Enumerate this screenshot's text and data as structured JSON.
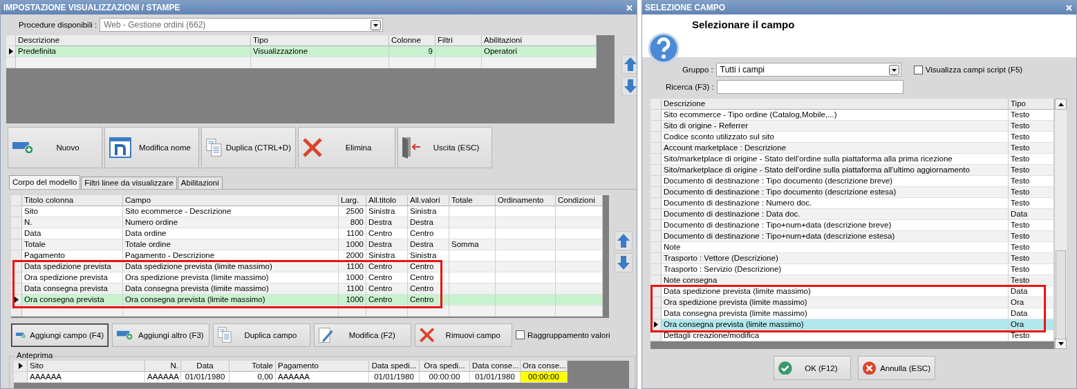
{
  "main_window": {
    "title": "IMPOSTAZIONE VISUALIZZAZIONI / STAMPE",
    "procedure": {
      "label": "Procedure disponibili :",
      "value": "Web - Gestione ordini (662)"
    },
    "models_table": {
      "columns": [
        "Descrizione",
        "Tipo",
        "Colonne",
        "Filtri",
        "Abilitazioni"
      ],
      "rows": [
        {
          "cells": [
            "Predefinita",
            "Visualizzazione",
            "9",
            "",
            "Operatori"
          ],
          "selected": true
        }
      ]
    },
    "toolbar": [
      {
        "label": "Nuovo",
        "kind": "new"
      },
      {
        "label": "Modifica nome",
        "kind": "rename"
      },
      {
        "label": "Duplica (CTRL+D)",
        "kind": "duplicate"
      },
      {
        "label": "Elimina",
        "kind": "delete"
      },
      {
        "label": "Uscita (ESC)",
        "kind": "exit"
      }
    ],
    "tabs": [
      {
        "label": "Corpo del modello",
        "selected": true
      },
      {
        "label": "Filtri linee da visualizzare",
        "selected": false
      },
      {
        "label": "Abilitazioni",
        "selected": false
      }
    ],
    "columns_table": {
      "columns": [
        "Titolo colonna",
        "Campo",
        "Larg.",
        "All.titolo",
        "All.valori",
        "Totale",
        "Ordinamento",
        "Condizioni"
      ],
      "rows": [
        {
          "cells": [
            "Sito",
            "Sito ecommerce - Descrizione",
            "2500",
            "Sinistra",
            "Sinistra",
            "",
            "",
            ""
          ],
          "selected": false,
          "marked": false
        },
        {
          "cells": [
            "N.",
            "Numero ordine",
            "800",
            "Destra",
            "Destra",
            "",
            "",
            ""
          ],
          "selected": false,
          "marked": false
        },
        {
          "cells": [
            "Data",
            "Data ordine",
            "1100",
            "Centro",
            "Centro",
            "",
            "",
            ""
          ],
          "selected": false,
          "marked": false
        },
        {
          "cells": [
            "Totale",
            "Totale ordine",
            "1000",
            "Destra",
            "Destra",
            "Somma",
            "",
            ""
          ],
          "selected": false,
          "marked": false
        },
        {
          "cells": [
            "Pagamento",
            "Pagamento - Descrizione",
            "2000",
            "Sinistra",
            "Sinistra",
            "",
            "",
            ""
          ],
          "selected": false,
          "marked": false
        },
        {
          "cells": [
            "Data spedizione prevista",
            "Data spedizione prevista (limite massimo)",
            "1100",
            "Centro",
            "Centro",
            "",
            "",
            ""
          ],
          "selected": false,
          "marked": true
        },
        {
          "cells": [
            "Ora spedizione prevista",
            "Ora spedizione prevista (limite massimo)",
            "1000",
            "Centro",
            "Centro",
            "",
            "",
            ""
          ],
          "selected": false,
          "marked": true
        },
        {
          "cells": [
            "Data consegna prevista",
            "Data consegna prevista (limite massimo)",
            "1100",
            "Centro",
            "Centro",
            "",
            "",
            ""
          ],
          "selected": false,
          "marked": true
        },
        {
          "cells": [
            "Ora consegna prevista",
            "Ora consegna prevista (limite massimo)",
            "1000",
            "Centro",
            "Centro",
            "",
            "",
            ""
          ],
          "selected": true,
          "marked": true
        }
      ]
    },
    "field_buttons": [
      {
        "label": "Aggiungi campo (F4)",
        "kind": "new",
        "focused": true
      },
      {
        "label": "Aggiungi altro (F3)",
        "kind": "new",
        "focused": false
      },
      {
        "label": "Duplica campo",
        "kind": "duplicate",
        "focused": false
      },
      {
        "label": "Modifica (F2)",
        "kind": "edit",
        "focused": false
      },
      {
        "label": "Rimuovi campo",
        "kind": "delete",
        "focused": false
      }
    ],
    "grouping_checkbox": {
      "label": "Raggruppamento valori",
      "checked": false
    },
    "preview": {
      "title": "Anteprima",
      "columns": [
        {
          "label": "Sito",
          "kind": "text",
          "highlighted": false
        },
        {
          "label": "N.",
          "kind": "number",
          "highlighted": false
        },
        {
          "label": "Data",
          "kind": "date",
          "highlighted": false
        },
        {
          "label": "Totale",
          "kind": "number",
          "highlighted": false
        },
        {
          "label": "Pagamento",
          "kind": "text",
          "highlighted": false
        },
        {
          "label": "Data spedi...",
          "kind": "date",
          "highlighted": false
        },
        {
          "label": "Ora spedi...",
          "kind": "date",
          "highlighted": false
        },
        {
          "label": "Data conse...",
          "kind": "date",
          "highlighted": false
        },
        {
          "label": "Ora conse...",
          "kind": "date",
          "highlighted": true
        }
      ],
      "rows": [
        {
          "cells": [
            "AAAAAA",
            "AAAAAA",
            "01/01/1980",
            "0,00",
            "AAAAAA",
            "01/01/1980",
            "00:00:00",
            "01/01/1980",
            "00:00:00"
          ]
        }
      ]
    }
  },
  "field_dialog": {
    "title": "SELEZIONE CAMPO",
    "heading": "Selezionare il campo",
    "group": {
      "label": "Gruppo :",
      "value": "Tutti i campi"
    },
    "script_checkbox": {
      "label": "Visualizza campi script (F5)",
      "checked": false
    },
    "search": {
      "label": "Ricerca (F3) :"
    },
    "list": {
      "columns": [
        "Descrizione",
        "Tipo"
      ],
      "rows": [
        {
          "description": "Sito ecommerce - Tipo ordine (Catalog,Mobile,...)",
          "type": "Testo",
          "selected": false,
          "marked": false
        },
        {
          "description": "Sito di origine - Referrer",
          "type": "Testo",
          "selected": false,
          "marked": false
        },
        {
          "description": "Codice sconto utilizzato sul sito",
          "type": "Testo",
          "selected": false,
          "marked": false
        },
        {
          "description": "Account marketplace : Descrizione",
          "type": "Testo",
          "selected": false,
          "marked": false
        },
        {
          "description": "Sito/marketplace di origine - Stato dell'ordine sulla piattaforma alla prima ricezione",
          "type": "Testo",
          "selected": false,
          "marked": false
        },
        {
          "description": "Sito/marketplace di origine - Stato dell'ordine sulla piattaforma all'ultimo aggiornamento",
          "type": "Testo",
          "selected": false,
          "marked": false
        },
        {
          "description": "Documento di destinazione : Tipo documento (descrizione breve)",
          "type": "Testo",
          "selected": false,
          "marked": false
        },
        {
          "description": "Documento di destinazione : Tipo documento (descrizione estesa)",
          "type": "Testo",
          "selected": false,
          "marked": false
        },
        {
          "description": "Documento di destinazione : Numero doc.",
          "type": "Testo",
          "selected": false,
          "marked": false
        },
        {
          "description": "Documento di destinazione : Data doc.",
          "type": "Data",
          "selected": false,
          "marked": false
        },
        {
          "description": "Documento di destinazione : Tipo+num+data (descrizione breve)",
          "type": "Testo",
          "selected": false,
          "marked": false
        },
        {
          "description": "Documento di destinazione : Tipo+num+data (descrizione estesa)",
          "type": "Testo",
          "selected": false,
          "marked": false
        },
        {
          "description": "Note",
          "type": "Testo",
          "selected": false,
          "marked": false
        },
        {
          "description": "Trasporto : Vettore (Descrizione)",
          "type": "Testo",
          "selected": false,
          "marked": false
        },
        {
          "description": "Trasporto : Servizio (Descrizione)",
          "type": "Testo",
          "selected": false,
          "marked": false
        },
        {
          "description": "Note consegna",
          "type": "Testo",
          "selected": false,
          "marked": false
        },
        {
          "description": "Data spedizione prevista (limite massimo)",
          "type": "Data",
          "selected": false,
          "marked": true
        },
        {
          "description": "Ora spedizione prevista (limite massimo)",
          "type": "Ora",
          "selected": false,
          "marked": true
        },
        {
          "description": "Data consegna prevista (limite massimo)",
          "type": "Data",
          "selected": false,
          "marked": true
        },
        {
          "description": "Ora consegna prevista (limite massimo)",
          "type": "Ora",
          "selected": true,
          "marked": true
        },
        {
          "description": "Dettagli creazione/modifica",
          "type": "Testo",
          "selected": false,
          "marked": false
        }
      ]
    },
    "buttons": [
      {
        "label": "OK (F12)",
        "kind": "ok"
      },
      {
        "label": "Annulla (ESC)",
        "kind": "cancel"
      }
    ]
  }
}
